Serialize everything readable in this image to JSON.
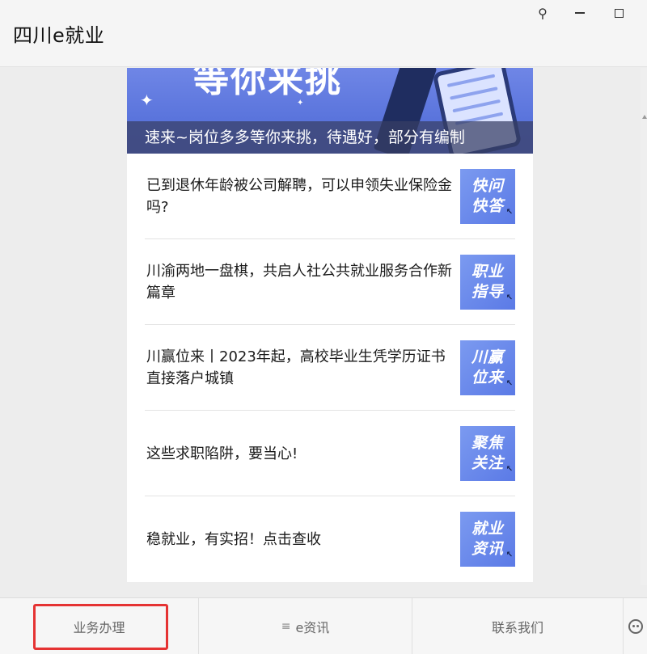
{
  "window": {
    "title": "四川e就业",
    "pin_glyph": "⚲"
  },
  "banner": {
    "headline": "等你来挑",
    "caption": "速来~岗位多多等你来挑，待遇好，部分有编制"
  },
  "news": [
    {
      "title": "已到退休年龄被公司解聘，可以申领失业保险金吗?",
      "thumb_line1": "快问",
      "thumb_line2": "快答"
    },
    {
      "title": "川渝两地一盘棋，共启人社公共就业服务合作新篇章",
      "thumb_line1": "职业",
      "thumb_line2": "指导"
    },
    {
      "title": "川赢位来丨2023年起，高校毕业生凭学历证书直接落户城镇",
      "thumb_line1": "川赢",
      "thumb_line2": "位来"
    },
    {
      "title": "这些求职陷阱，要当心!",
      "thumb_line1": "聚焦",
      "thumb_line2": "关注"
    },
    {
      "title": "稳就业，有实招！点击查收",
      "thumb_line1": "就业",
      "thumb_line2": "资讯"
    }
  ],
  "tabs": {
    "business": "业务办理",
    "menu_icon": "≡",
    "news": "e资讯",
    "contact": "联系我们"
  },
  "colors": {
    "accent": "#5b7ae6",
    "highlight": "#e53333"
  }
}
